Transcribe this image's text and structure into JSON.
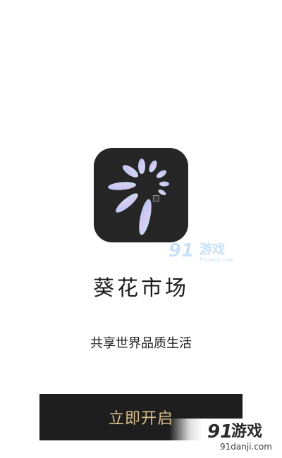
{
  "app": {
    "logo_icon": "sunflower-petals-icon",
    "name": "葵花市场",
    "tagline": "共享世界品质生活"
  },
  "actions": {
    "start_label": "立即开启"
  },
  "watermarks": {
    "small": {
      "number": "91",
      "text": "游戏",
      "url": "91danji.com"
    },
    "corner": {
      "number": "91",
      "text": "游戏",
      "url": "91danji.com"
    }
  },
  "colors": {
    "background": "#ffffff",
    "logo_background": "#262626",
    "button_background": "#1e1e1e",
    "button_text": "#d9bf8c",
    "primary_text": "#1c1c1c"
  }
}
